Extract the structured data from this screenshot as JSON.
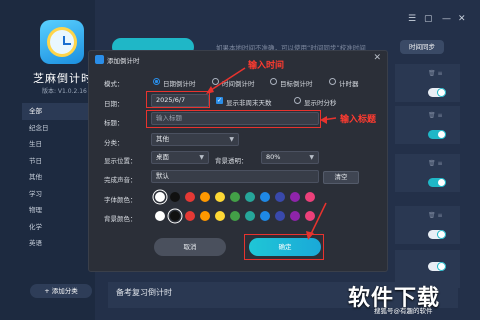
{
  "app": {
    "title": "芝麻倒计时",
    "version": "版本: V1.0.2.16",
    "hint": "如果本地时间不准确，可以使用“时间同步”校准时间",
    "sync_button": "时间同步",
    "nav_items": [
      "全部",
      "纪念日",
      "生日",
      "节日",
      "其他",
      "学习",
      "物理",
      "化学",
      "英语"
    ],
    "add_category": "+ 添加分类",
    "bottom_card_title": "备考复习倒计时"
  },
  "dialog": {
    "title": "添加倒计时",
    "mode_label": "模式：",
    "modes": [
      "日期倒计时",
      "时间倒计时",
      "目标倒计时",
      "计时器"
    ],
    "selected_mode": "日期倒计时",
    "date_label": "日期：",
    "date_value": "2025/6/7",
    "show_weekend_label": "显示非周末天数",
    "show_weekend_checked": true,
    "show_hms_label": "显示时分秒",
    "title_label": "标题：",
    "title_placeholder": "输入标题",
    "category_label": "分类：",
    "category_value": "其他",
    "position_label": "显示位置：",
    "position_value": "桌面",
    "opacity_label": "背景透明：",
    "opacity_value": "80%",
    "sound_label": "完成声音：",
    "sound_value": "默认",
    "clear_button": "清空",
    "font_color_label": "字体颜色：",
    "bg_color_label": "背景颜色：",
    "colors": [
      "#ffffff",
      "#111111",
      "#e53935",
      "#ff9800",
      "#fdd835",
      "#43a047",
      "#26a69a",
      "#1e88e5",
      "#3949ab",
      "#8e24aa",
      "#ec407a"
    ],
    "font_color_selected": "#ffffff",
    "bg_color_selected": "#111111",
    "cancel_button": "取消",
    "ok_button": "确定"
  },
  "annotations": {
    "input_time": "输入时间",
    "input_title": "输入标题"
  },
  "watermark": {
    "big": "软件下载",
    "small": "搜狐号@有趣的软件"
  }
}
